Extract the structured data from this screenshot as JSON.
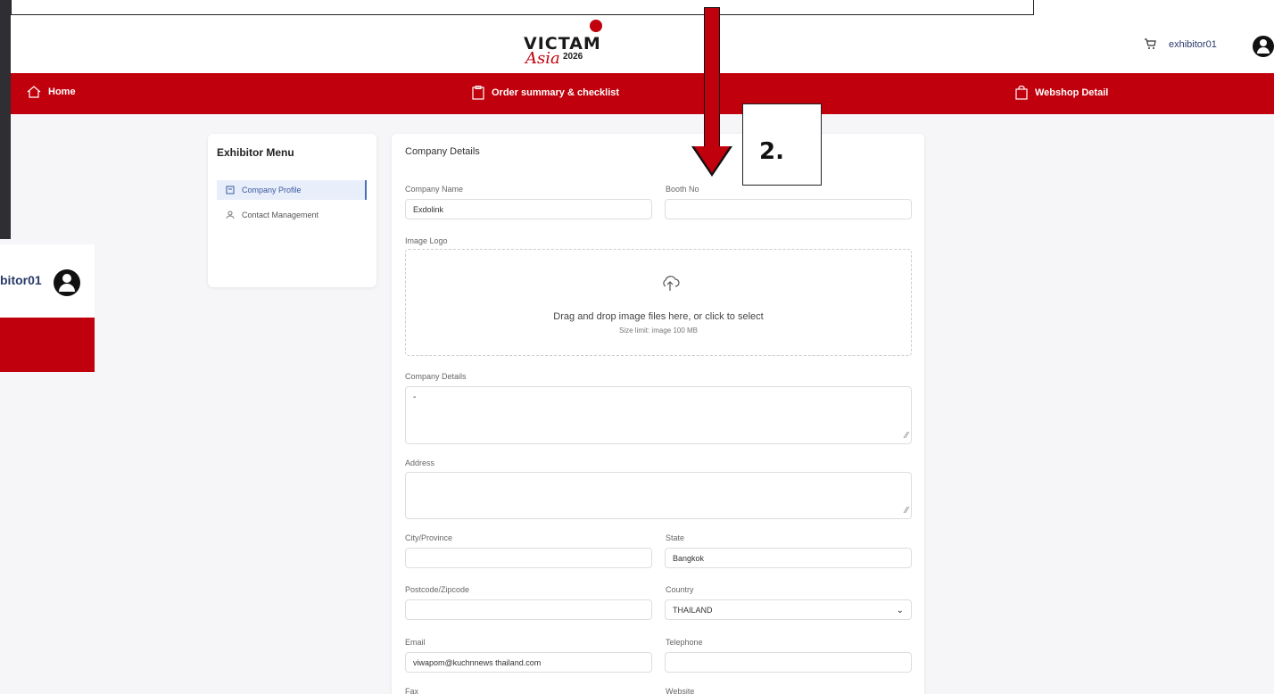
{
  "header": {
    "logo_text": "VICTAM",
    "logo_subtext": "Asia",
    "logo_year": "2026",
    "user_name": "exhibitor01",
    "icons": {
      "cart": "cart-icon",
      "avatar": "avatar-icon"
    }
  },
  "nav": {
    "home": "Home",
    "order_summary": "Order summary & checklist",
    "webshop": "Webshop Detail"
  },
  "side_panel": {
    "user_name": "bitor01"
  },
  "menu": {
    "title": "Exhibitor Menu",
    "items": [
      {
        "label": "Company Profile",
        "active": true,
        "icon": "profile-icon"
      },
      {
        "label": "Contact Management",
        "active": false,
        "icon": "contacts-icon"
      }
    ]
  },
  "form": {
    "title": "Company Details",
    "company_name_label": "Company Name",
    "company_name_value": "Exdolink",
    "booth_no_label": "Booth No",
    "booth_no_value": "",
    "image_logo_label": "Image Logo",
    "dropzone_text": "Drag and drop image files here, or click to select",
    "dropzone_subtext": "Size limit: image 100 MB",
    "company_details_label": "Company Details",
    "company_details_value": "-",
    "address_label": "Address",
    "address_value": "",
    "city_label": "City/Province",
    "city_value": "",
    "state_label": "State",
    "state_value": "Bangkok",
    "postcode_label": "Postcode/Zipcode",
    "postcode_value": "",
    "country_label": "Country",
    "country_value": "THAILAND",
    "email_label": "Email",
    "email_value": "viwapom@kuchnnews thailand.com",
    "telephone_label": "Telephone",
    "telephone_value": "",
    "fax_label": "Fax",
    "website_label": "Website"
  },
  "annotation": {
    "step": "2."
  },
  "colors": {
    "brand_red": "#c0000c",
    "accent_blue": "#4a6fbf"
  }
}
